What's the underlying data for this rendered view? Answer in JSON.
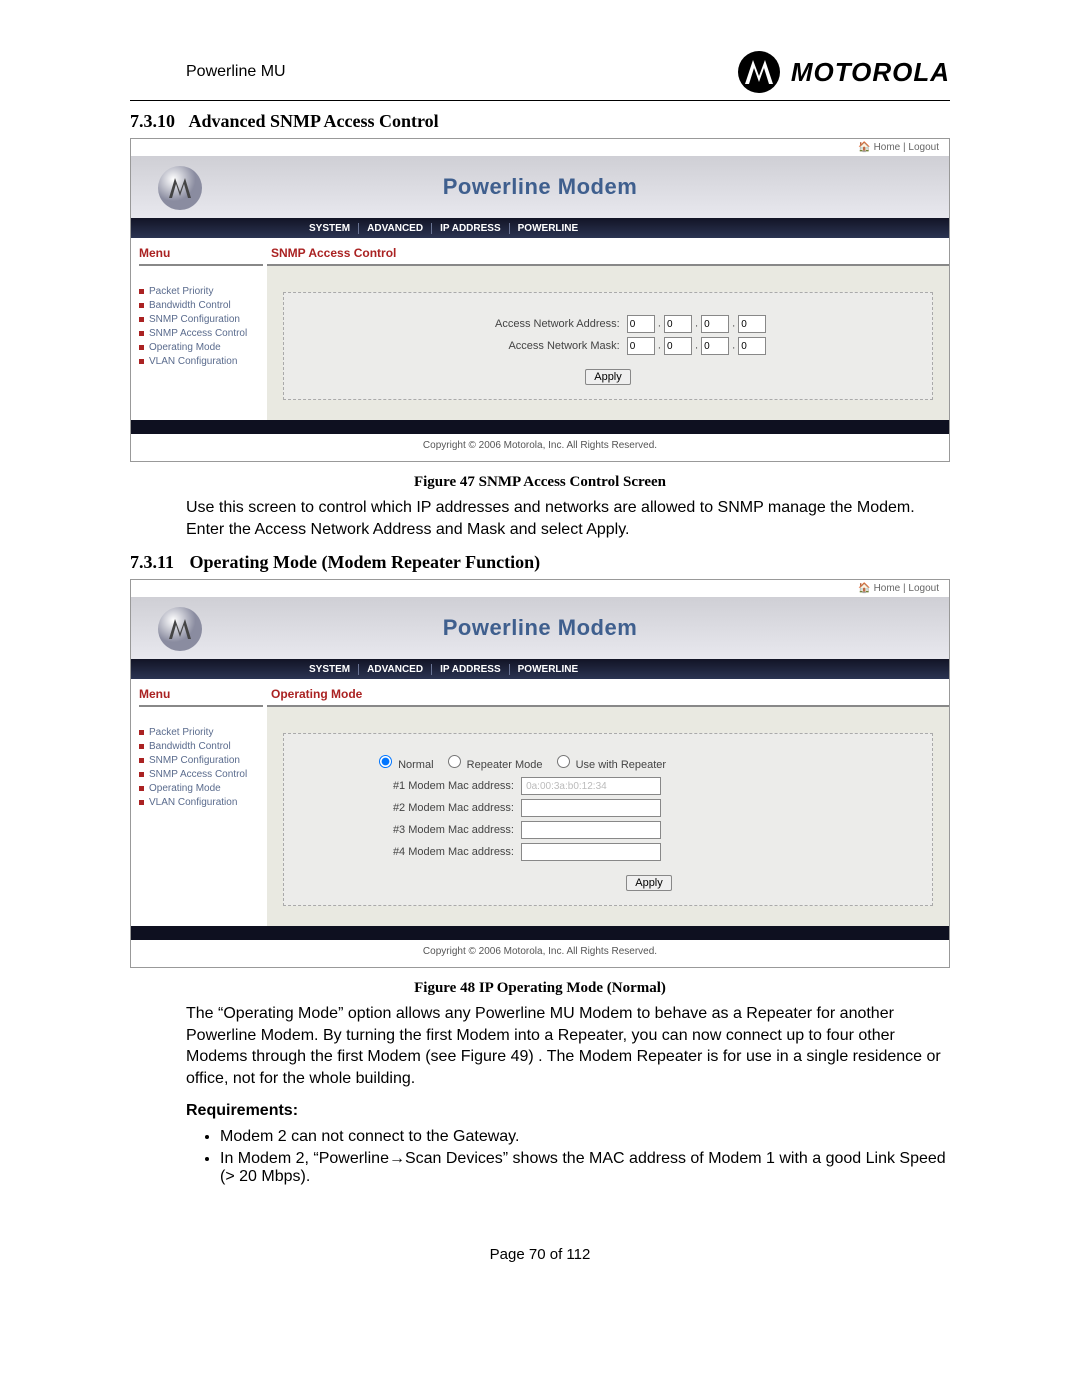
{
  "doc": {
    "product": "Powerline MU",
    "brand": "MOTOROLA",
    "page_number": "Page 70 of 112"
  },
  "sections": {
    "s1": {
      "num": "7.3.10",
      "title": "Advanced SNMP Access Control"
    },
    "s2": {
      "num": "7.3.11",
      "title": "Operating Mode (Modem Repeater Function)"
    }
  },
  "figures": {
    "f1": "Figure 47 SNMP Access Control Screen",
    "f2": "Figure 48 IP Operating Mode (Normal)"
  },
  "paragraphs": {
    "p1": "Use this screen to control which IP addresses and networks are allowed to SNMP manage the Modem. Enter the Access Network Address and Mask and select Apply.",
    "p2": "The “Operating Mode” option allows any Powerline MU Modem to behave as a Repeater for another Powerline Modem.  By turning the first Modem into a Repeater, you can now connect up to four other Modems through the first Modem (see Figure 49) . The Modem Repeater is for use in a single residence or office, not for the whole building.",
    "req_label": "Requirements:",
    "req1": "Modem 2 can not connect to the Gateway.",
    "req2": "In Modem 2, “Powerline→Scan Devices” shows the MAC address of Modem 1 with a good Link Speed (> 20 Mbps)."
  },
  "ui": {
    "topbar": {
      "home": "Home",
      "logout": "Logout"
    },
    "banner_title": "Powerline Modem",
    "nav": {
      "system": "SYSTEM",
      "advanced": "ADVANCED",
      "ip": "IP ADDRESS",
      "powerline": "POWERLINE"
    },
    "menu": {
      "head": "Menu",
      "items": [
        "Packet Priority",
        "Bandwidth Control",
        "SNMP Configuration",
        "SNMP Access Control",
        "Operating Mode",
        "VLAN Configuration"
      ]
    },
    "copyright": "Copyright  ©   2006  Motorola, Inc.  All Rights Reserved.",
    "panel1": {
      "head": "SNMP Access Control",
      "addr_label": "Access Network Address:",
      "mask_label": "Access Network Mask:",
      "addr": [
        "0",
        "0",
        "0",
        "0"
      ],
      "mask": [
        "0",
        "0",
        "0",
        "0"
      ],
      "apply": "Apply"
    },
    "panel2": {
      "head": "Operating Mode",
      "opt_normal": "Normal",
      "opt_rep": "Repeater Mode",
      "opt_use": "Use with Repeater",
      "mac1_label": "#1 Modem Mac address:",
      "mac2_label": "#2 Modem Mac address:",
      "mac3_label": "#3 Modem Mac address:",
      "mac4_label": "#4 Modem Mac address:",
      "mac1_value": "0a:00:3a:b0:12:34",
      "apply": "Apply"
    }
  }
}
